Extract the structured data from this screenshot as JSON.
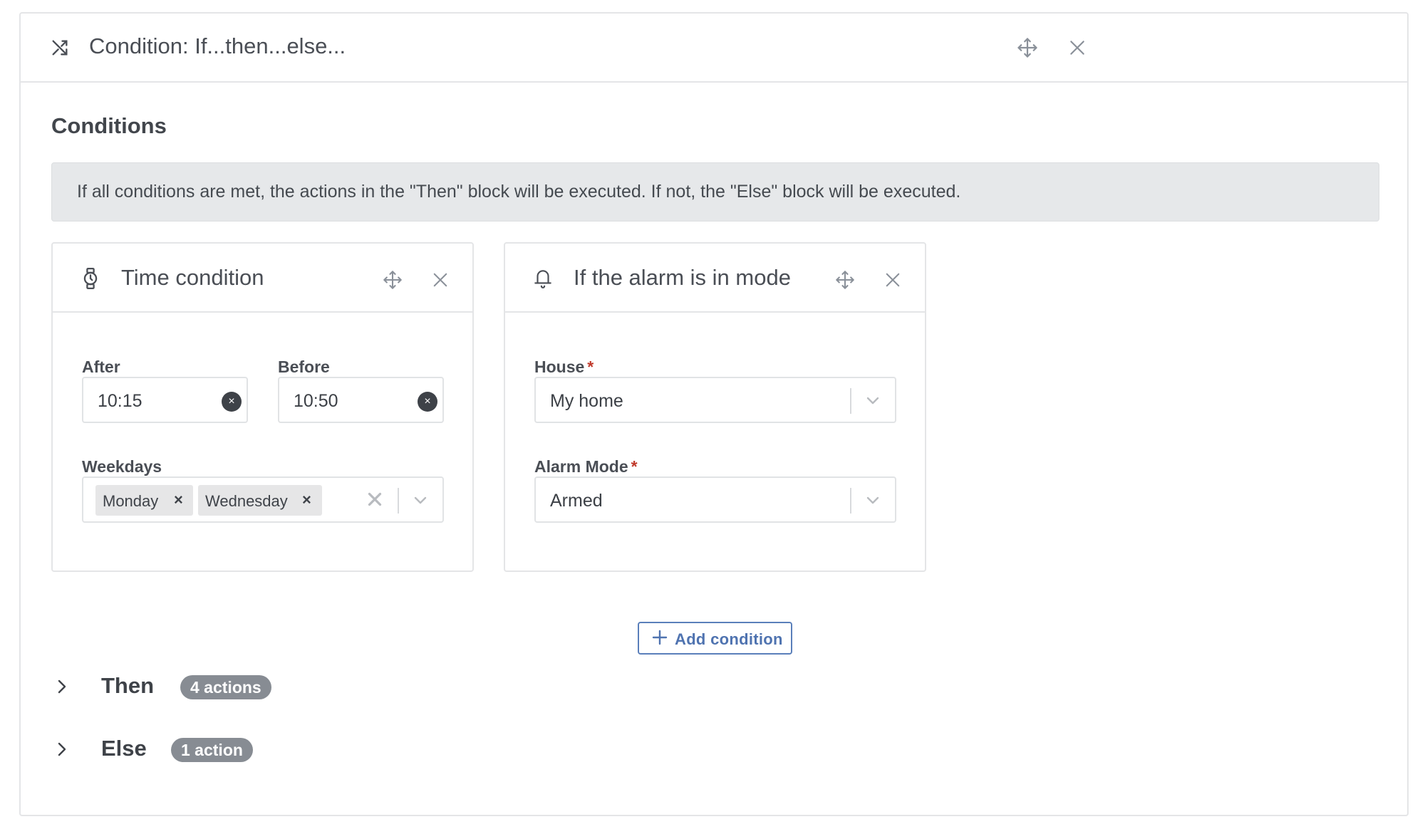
{
  "panel": {
    "title": "Condition: If...then...else...",
    "icon": "shuffle-icon",
    "move_icon": "move-icon",
    "close_icon": "close-icon"
  },
  "conditions": {
    "heading": "Conditions",
    "info": "If all conditions are met, the actions in the \"Then\" block will be executed. If not, the \"Else\" block will be executed."
  },
  "time_condition": {
    "title": "Time condition",
    "icon": "watch-icon",
    "after_label": "After",
    "after_value": "10:15",
    "before_label": "Before",
    "before_value": "10:50",
    "weekdays_label": "Weekdays",
    "weekdays": [
      "Monday",
      "Wednesday"
    ],
    "chip_remove": "×",
    "clear_glyph": "×"
  },
  "alarm_condition": {
    "title": "If the alarm is in mode",
    "icon": "bell-icon",
    "house_label": "House",
    "house_value": "My home",
    "mode_label": "Alarm Mode",
    "mode_value": "Armed",
    "required_mark": "*"
  },
  "add_condition": {
    "label": "Add condition"
  },
  "branches": [
    {
      "name": "Then",
      "badge": "4 actions"
    },
    {
      "name": "Else",
      "badge": "1 action"
    }
  ],
  "colors": {
    "accent": "#4f73b0",
    "required": "#c0392b",
    "badge_bg": "#878c93",
    "info_bg": "#e6e8ea"
  }
}
